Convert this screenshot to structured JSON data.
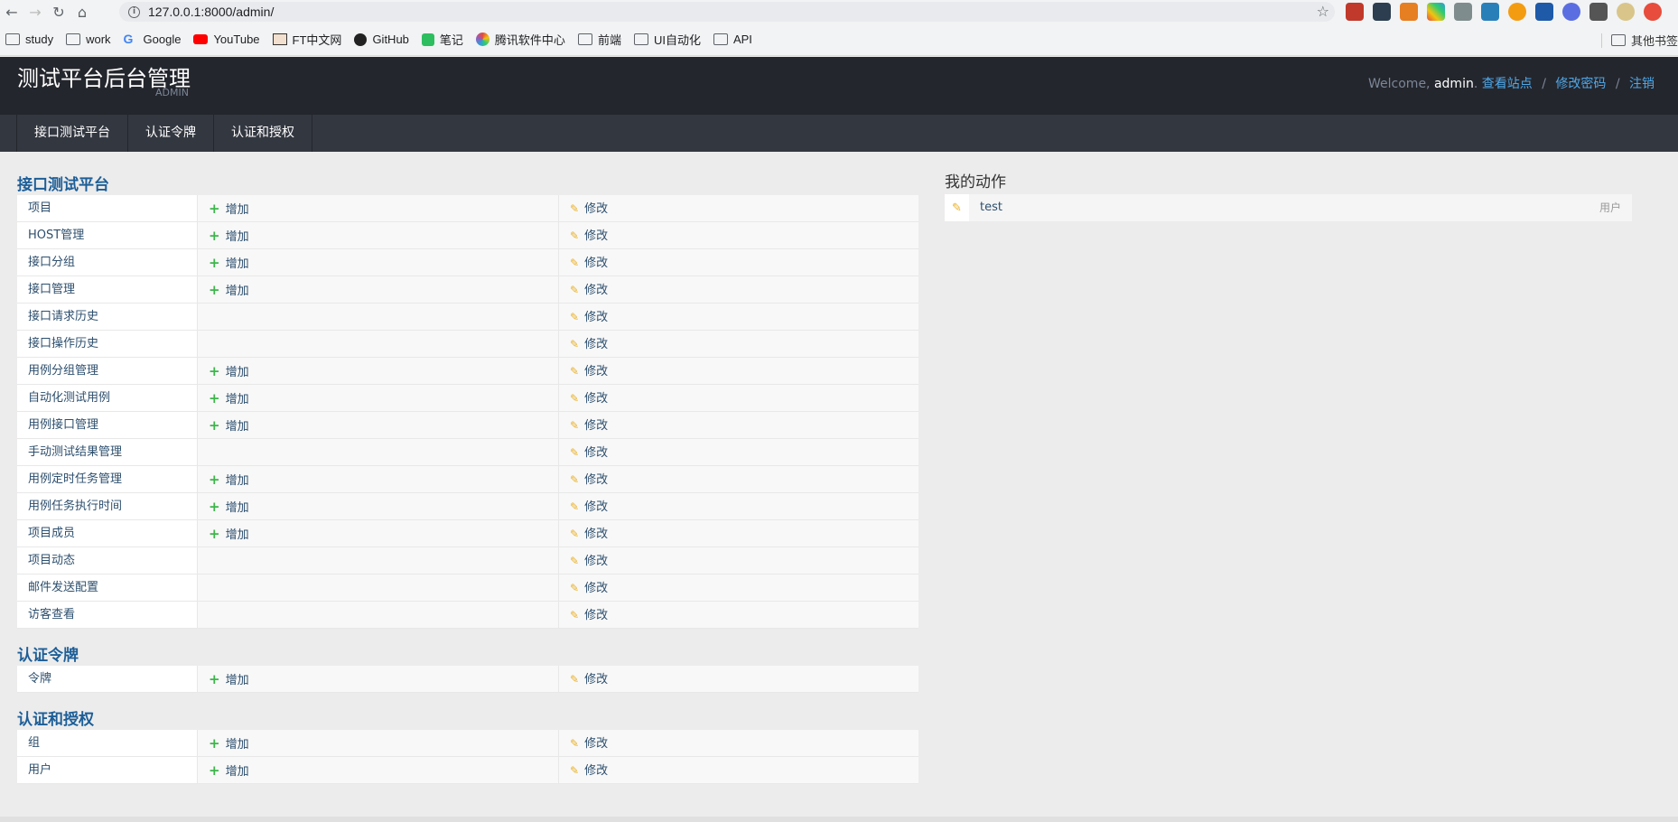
{
  "browser": {
    "url": "127.0.0.1:8000/admin/",
    "bookmarks": [
      "study",
      "work",
      "Google",
      "YouTube",
      "FT中文网",
      "GitHub",
      "笔记",
      "腾讯软件中心",
      "前端",
      "UI自动化",
      "API"
    ],
    "other_bookmarks": "其他书签"
  },
  "header": {
    "title": "测试平台后台管理",
    "subtitle": "ADMIN",
    "welcome": "Welcome,",
    "username": "admin",
    "view_site": "查看站点",
    "change_password": "修改密码",
    "logout": "注销"
  },
  "nav": [
    "接口测试平台",
    "认证令牌",
    "认证和授权"
  ],
  "labels": {
    "add": "增加",
    "change": "修改"
  },
  "sections": [
    {
      "title": "接口测试平台",
      "models": [
        {
          "name": "项目",
          "add": true
        },
        {
          "name": "HOST管理",
          "add": true
        },
        {
          "name": "接口分组",
          "add": true
        },
        {
          "name": "接口管理",
          "add": true
        },
        {
          "name": "接口请求历史",
          "add": false
        },
        {
          "name": "接口操作历史",
          "add": false
        },
        {
          "name": "用例分组管理",
          "add": true
        },
        {
          "name": "自动化测试用例",
          "add": true
        },
        {
          "name": "用例接口管理",
          "add": true
        },
        {
          "name": "手动测试结果管理",
          "add": false
        },
        {
          "name": "用例定时任务管理",
          "add": true
        },
        {
          "name": "用例任务执行时间",
          "add": true
        },
        {
          "name": "项目成员",
          "add": true
        },
        {
          "name": "项目动态",
          "add": false
        },
        {
          "name": "邮件发送配置",
          "add": false
        },
        {
          "name": "访客查看",
          "add": false
        }
      ]
    },
    {
      "title": "认证令牌",
      "models": [
        {
          "name": "令牌",
          "add": true
        }
      ]
    },
    {
      "title": "认证和授权",
      "models": [
        {
          "name": "组",
          "add": true
        },
        {
          "name": "用户",
          "add": true
        }
      ]
    }
  ],
  "recent_actions": {
    "title": "我的动作",
    "items": [
      {
        "name": "test",
        "type": "用户"
      }
    ]
  },
  "colors": {
    "header_bg": "#24262d",
    "nav_bg": "#333740",
    "link": "#4fa8e8",
    "add_icon": "#3cb64a",
    "change_icon": "#e9b024"
  }
}
